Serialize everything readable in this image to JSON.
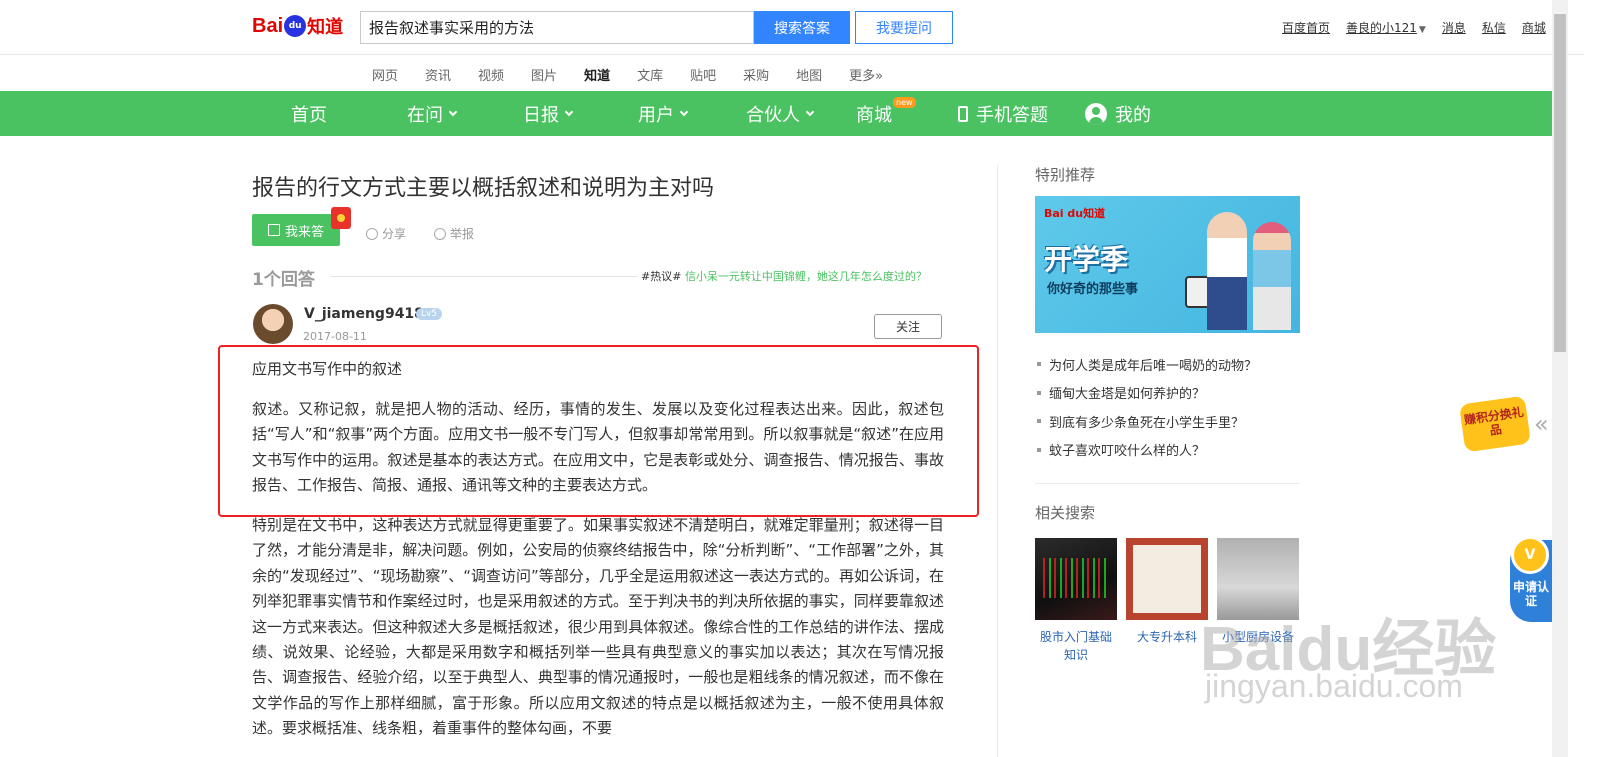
{
  "header": {
    "logo": {
      "bai": "Bai",
      "du": "du",
      "zhidao": "知道"
    },
    "search": {
      "value": "报告叙述事实采用的方法"
    },
    "search_button": "搜索答案",
    "ask_button": "我要提问",
    "top_links": [
      "百度首页",
      "善良的小121",
      "消息",
      "私信",
      "商城"
    ]
  },
  "subnav": {
    "items": [
      "网页",
      "资讯",
      "视频",
      "图片",
      "知道",
      "文库",
      "贴吧",
      "采购",
      "地图",
      "更多»"
    ],
    "active": "知道"
  },
  "greennav": {
    "home": "首页",
    "zaiwen": "在问",
    "ribao": "日报",
    "yonghu": "用户",
    "hehuoren": "合伙人",
    "shangcheng": "商城",
    "new_badge": "new",
    "phone": "手机答题",
    "mine": "我的"
  },
  "question": {
    "title": "报告的行文方式主要以概括叙述和说明为主对吗",
    "answer_button": "我来答",
    "share": "分享",
    "report": "举报"
  },
  "answers": {
    "count_label": "1个回答",
    "hot_topic_tag": "#热议#",
    "hot_topic_text": "信小呆一元转让中国锦鲤，她这几年怎么度过的？",
    "user": {
      "name": "V_jiameng9418",
      "level": "Lv5",
      "date": "2017-08-11"
    },
    "follow_button": "关注",
    "paragraphs": {
      "heading": "应用文书写作中的叙述",
      "one": "叙述。又称记叙，就是把人物的活动、经历，事情的发生、发展以及变化过程表达出来。因此，叙述包括“写人”和“叙事”两个方面。应用文书一般不专门写人，但叙事却常常用到。所以叙事就是“叙述”在应用文书写作中的运用。叙述是基本的表达方式。在应用文中，它是表彰或处分、调查报告、情况报告、事故报告、工作报告、简报、通报、通讯等文种的主要表达方式。",
      "two": "特别是在文书中，这种表达方式就显得更重要了。如果事实叙述不清楚明白，就难定罪量刑；叙述得一目了然，才能分清是非，解决问题。例如，公安局的侦察终结报告中，除“分析判断”、“工作部署”之外，其余的“发现经过”、“现场勘察”、“调查访问”等部分，几乎全是运用叙述这一表达方式的。再如公诉词，在列举犯罪事实情节和作案经过时，也是采用叙述的方式。至于判决书的判决所依据的事实，同样要靠叙述这一方式来表达。但这种叙述大多是概括叙述，很少用到具体叙述。像综合性的工作总结的讲作法、摆成绩、说效果、论经验，大都是采用数字和概括列举一些具有典型意义的事实加以表达；其次在写情况报告、调查报告、经验介绍，以至于典型人、典型事的情况通报时，一般也是粗线条的情况叙述，而不像在文学作品的写作上那样细腻，富于形象。所以应用文叙述的特点是以概括叙述为主，一般不使用具体叙述。要求概括准、线条粗，着重事件的整体勾画，不要"
    }
  },
  "sidebar": {
    "featured_title": "特别推荐",
    "promo": {
      "logo": "Bai du知道",
      "headline": "开学季",
      "subline": "你好奇的那些事"
    },
    "recommendations": [
      "为何人类是成年后唯一喝奶的动物？",
      "缅甸大金塔是如何养护的？",
      "到底有多少条鱼死在小学生手里？",
      "蚊子喜欢叮咬什么样的人？"
    ],
    "related_title": "相关搜索",
    "related": [
      {
        "label": "股市入门基础知识"
      },
      {
        "label": "大专升本科"
      },
      {
        "label": "小型厨房设备"
      }
    ]
  },
  "floating": {
    "points_badge": "赚积分换礼品",
    "collapse": "«",
    "cert_icon": "V",
    "cert_label": "申请认证"
  },
  "watermark": {
    "main": "Baidu经验",
    "sub": "jingyan.baidu.com"
  },
  "colors": {
    "brand_green": "#4bc262",
    "brand_blue": "#3385ff",
    "highlight_red": "#ee2222"
  }
}
